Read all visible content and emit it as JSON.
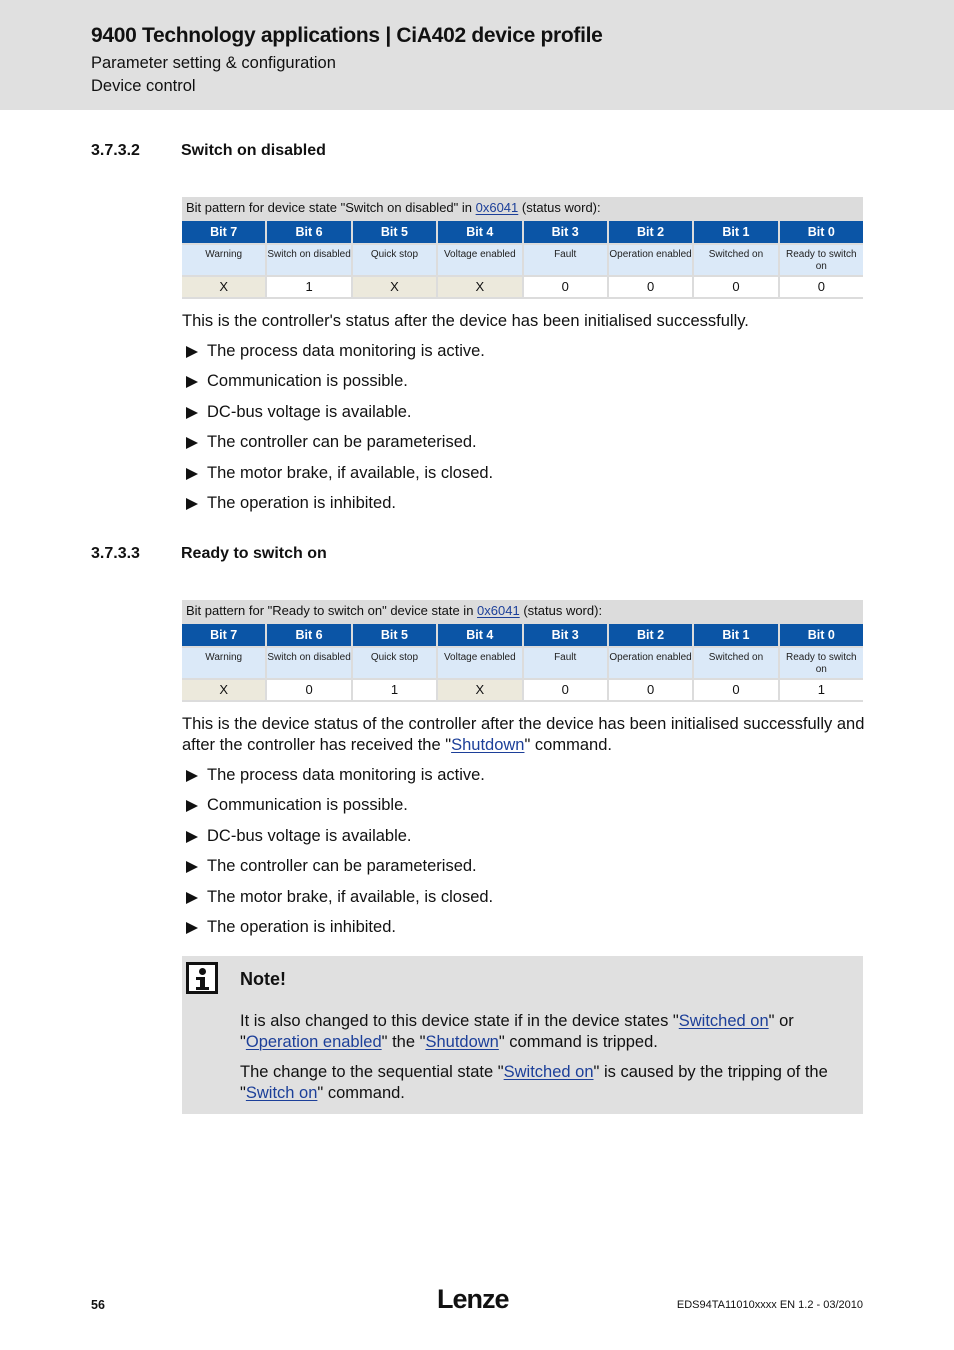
{
  "header": {
    "title": "9400 Technology applications | CiA402 device profile",
    "subtitle1": "Parameter setting & configuration",
    "subtitle2": "Device control"
  },
  "section1": {
    "number": "3.7.3.2",
    "title": "Switch on disabled",
    "table": {
      "caption_pre": "Bit pattern for device state \"Switch on disabled\" in ",
      "caption_link": "0x6041",
      "caption_post": " (status word):",
      "headers": [
        "Bit 7",
        "Bit 6",
        "Bit 5",
        "Bit 4",
        "Bit 3",
        "Bit 2",
        "Bit 1",
        "Bit 0"
      ],
      "descriptions": [
        "Warning",
        "Switch on disabled",
        "Quick stop",
        "Voltage enabled",
        "Fault",
        "Operation enabled",
        "Switched on",
        "Ready to switch on"
      ],
      "values": [
        "X",
        "1",
        "X",
        "X",
        "0",
        "0",
        "0",
        "0"
      ]
    },
    "intro": "This is the controller's status after the device has been initialised successfully.",
    "bullets": [
      "The process data monitoring is active.",
      "Communication is possible.",
      "DC-bus voltage is available.",
      "The controller can be parameterised.",
      "The motor brake, if available, is closed.",
      "The operation is inhibited."
    ]
  },
  "section2": {
    "number": "3.7.3.3",
    "title": "Ready to switch on",
    "table": {
      "caption_pre": "Bit pattern for \"Ready to switch on\" device state in ",
      "caption_link": "0x6041",
      "caption_post": " (status word):",
      "headers": [
        "Bit 7",
        "Bit 6",
        "Bit 5",
        "Bit 4",
        "Bit 3",
        "Bit 2",
        "Bit 1",
        "Bit 0"
      ],
      "descriptions": [
        "Warning",
        "Switch on disabled",
        "Quick stop",
        "Voltage enabled",
        "Fault",
        "Operation enabled",
        "Switched on",
        "Ready to switch on"
      ],
      "values": [
        "X",
        "0",
        "1",
        "X",
        "0",
        "0",
        "0",
        "1"
      ]
    },
    "intro_pre": "This is the device status of the controller after the device has been initialised successfully and after the controller has received the \"",
    "intro_link": "Shutdown",
    "intro_post": "\" command.",
    "bullets": [
      "The process data monitoring is active.",
      "Communication is possible.",
      "DC-bus voltage is available.",
      "The controller can be parameterised.",
      "The motor brake, if available, is closed.",
      "The operation is inhibited."
    ]
  },
  "note": {
    "icon": "info-icon",
    "title": "Note!",
    "p1": {
      "t1": "It is also changed to this device state if in the device states \"",
      "l1": "Switched on",
      "t2": "\" or \"",
      "l2": "Operation enabled",
      "t3": "\" the \"",
      "l3": "Shutdown",
      "t4": "\" command is tripped."
    },
    "p2": {
      "t1": "The change to the sequential state \"",
      "l1": "Switched on",
      "t2": "\" is caused by the tripping of the \"",
      "l2": "Switch on",
      "t3": "\" command."
    }
  },
  "footer": {
    "page_number": "56",
    "logo": "Lenze",
    "doc_id": "EDS94TA11010xxxx EN 1.2 - 03/2010"
  },
  "colors": {
    "header_bg": "#e0e0e0",
    "table_header_bg": "#0b55a6",
    "table_desc_bg": "#dbe9f8",
    "dont_care_bg": "#ece9dc",
    "link": "#1c3f99"
  }
}
